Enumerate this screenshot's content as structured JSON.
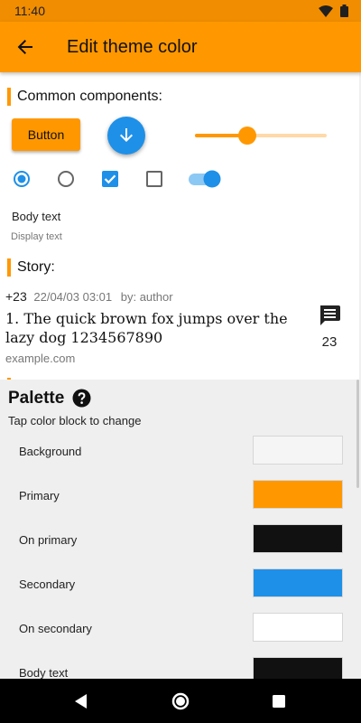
{
  "status_bar": {
    "time": "11:40",
    "icons": [
      "wifi-icon",
      "battery-icon"
    ]
  },
  "app_bar": {
    "title": "Edit theme color",
    "back_icon": "arrow-back-icon"
  },
  "common": {
    "section_title": "Common components:",
    "button_label": "Button",
    "fab_icon": "arrow-down-icon",
    "slider_value": 0.4,
    "radio_checked": true,
    "radio_unchecked": false,
    "checkbox_checked": true,
    "checkbox_unchecked": false,
    "switch_on": true,
    "body_text": "Body text",
    "display_text": "Display text"
  },
  "story": {
    "section_title": "Story:",
    "score": "+23",
    "date": "22/04/03 03:01",
    "author": "by: author",
    "title": "1. The quick brown fox jumps over the lazy dog 1234567890",
    "domain": "example.com",
    "comment_icon": "comment-icon",
    "comment_count": "23"
  },
  "palette": {
    "title": "Palette",
    "help_icon": "help-icon",
    "hint": "Tap color block to change",
    "items": [
      {
        "label": "Background",
        "color": "#f5f5f5"
      },
      {
        "label": "Primary",
        "color": "#ff9800"
      },
      {
        "label": "On primary",
        "color": "#111111"
      },
      {
        "label": "Secondary",
        "color": "#1e90e8"
      },
      {
        "label": "On secondary",
        "color": "#ffffff"
      },
      {
        "label": "Body text",
        "color": "#111111"
      }
    ]
  },
  "colors": {
    "primary": "#ff9800",
    "status_bar": "#f18d00",
    "secondary": "#1e90e8",
    "palette_bg": "#efefef"
  },
  "nav": {
    "icons": [
      "back-triangle-icon",
      "home-circle-icon",
      "recents-square-icon"
    ]
  }
}
